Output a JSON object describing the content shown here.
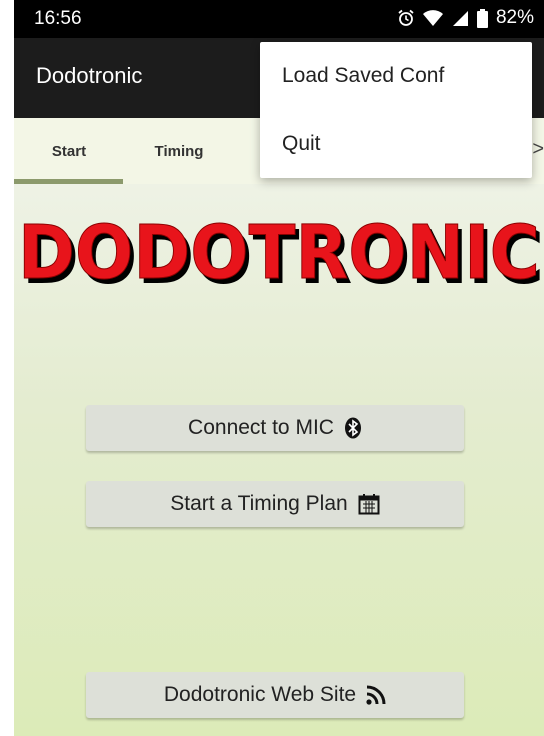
{
  "status_bar": {
    "time": "16:56",
    "battery": "82%",
    "icons": [
      "alarm-icon",
      "wifi-icon",
      "signal-icon",
      "battery-icon"
    ]
  },
  "app_bar": {
    "title": "Dodotronic"
  },
  "tabs": [
    {
      "label": "Start",
      "selected": true
    },
    {
      "label": "Timing",
      "selected": false
    }
  ],
  "tab_more_glyph": ">",
  "logo": {
    "text": "DODOTRONIC",
    "color": "#e8141b"
  },
  "buttons": {
    "connect": {
      "label": "Connect to MIC",
      "icon": "bluetooth-icon"
    },
    "timing": {
      "label": "Start a Timing Plan",
      "icon": "calendar-icon"
    },
    "web": {
      "label": "Dodotronic Web Site",
      "icon": "rss-icon"
    }
  },
  "menu": {
    "items": [
      {
        "label": "Load Saved Conf"
      },
      {
        "label": "Quit"
      }
    ]
  },
  "colors": {
    "app_bar": "#1c1c1c",
    "tab_bar": "#f3f6e6",
    "tab_indicator": "#8c9a6c",
    "background_gradient_end": "#dcebb8"
  }
}
